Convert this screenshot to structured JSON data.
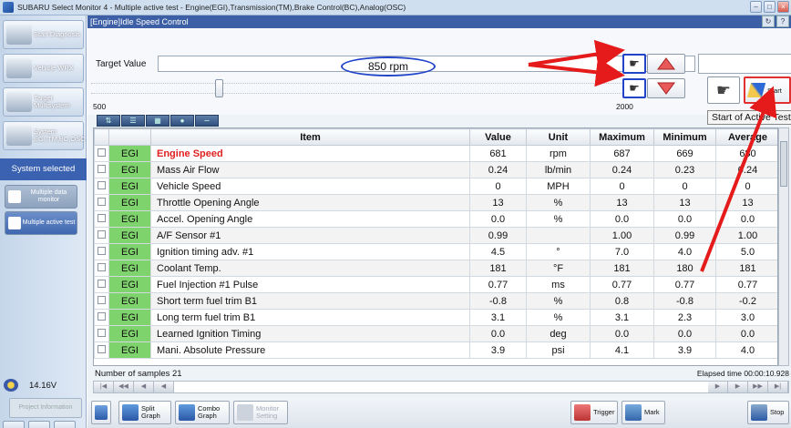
{
  "window": {
    "title": "SUBARU Select Monitor 4 - Multiple active test - Engine(EGI),Transmission(TM),Brake Control(BC),Analog(OSC)"
  },
  "sidebar": {
    "start": "Start Diagnosis",
    "vehicle": "Vehicle WRX",
    "target": "Target Multisystem",
    "system": "System EGI,TM,BC,OSC",
    "selected_label": "System selected",
    "multi_data": "Multiple data monitor",
    "multi_active": "Multiple active test",
    "voltage": "14.16V",
    "project_info": "Project Information"
  },
  "panel": {
    "header": "[Engine]Idle Speed Control",
    "target_label": "Target Value",
    "target_value": "850 rpm",
    "slider_min": "500",
    "slider_max": "2000",
    "slider_value": 850,
    "start_label": "Start",
    "tooltip": "Start of Active Test"
  },
  "table": {
    "headers": [
      "",
      "",
      "Item",
      "Value",
      "Unit",
      "Maximum",
      "Minimum",
      "Average"
    ],
    "rows": [
      {
        "sys": "EGI",
        "item": "Engine Speed",
        "value": "681",
        "unit": "rpm",
        "max": "687",
        "min": "669",
        "avg": "680"
      },
      {
        "sys": "EGI",
        "item": "Mass Air Flow",
        "value": "0.24",
        "unit": "lb/min",
        "max": "0.24",
        "min": "0.23",
        "avg": "0.24"
      },
      {
        "sys": "EGI",
        "item": "Vehicle Speed",
        "value": "0",
        "unit": "MPH",
        "max": "0",
        "min": "0",
        "avg": "0"
      },
      {
        "sys": "EGI",
        "item": "Throttle Opening Angle",
        "value": "13",
        "unit": "%",
        "max": "13",
        "min": "13",
        "avg": "13"
      },
      {
        "sys": "EGI",
        "item": "Accel. Opening Angle",
        "value": "0.0",
        "unit": "%",
        "max": "0.0",
        "min": "0.0",
        "avg": "0.0"
      },
      {
        "sys": "EGI",
        "item": "A/F Sensor #1",
        "value": "0.99",
        "unit": "",
        "max": "1.00",
        "min": "0.99",
        "avg": "1.00"
      },
      {
        "sys": "EGI",
        "item": "Ignition timing adv. #1",
        "value": "4.5",
        "unit": "°",
        "max": "7.0",
        "min": "4.0",
        "avg": "5.0"
      },
      {
        "sys": "EGI",
        "item": "Coolant Temp.",
        "value": "181",
        "unit": "°F",
        "max": "181",
        "min": "180",
        "avg": "181"
      },
      {
        "sys": "EGI",
        "item": "Fuel Injection #1 Pulse",
        "value": "0.77",
        "unit": "ms",
        "max": "0.77",
        "min": "0.77",
        "avg": "0.77"
      },
      {
        "sys": "EGI",
        "item": "Short term fuel trim B1",
        "value": "-0.8",
        "unit": "%",
        "max": "0.8",
        "min": "-0.8",
        "avg": "-0.2"
      },
      {
        "sys": "EGI",
        "item": "Long term fuel trim B1",
        "value": "3.1",
        "unit": "%",
        "max": "3.1",
        "min": "2.3",
        "avg": "3.0"
      },
      {
        "sys": "EGI",
        "item": "Learned Ignition Timing",
        "value": "0.0",
        "unit": "deg",
        "max": "0.0",
        "min": "0.0",
        "avg": "0.0"
      },
      {
        "sys": "EGI",
        "item": "Mani. Absolute Pressure",
        "value": "3.9",
        "unit": "psi",
        "max": "4.1",
        "min": "3.9",
        "avg": "4.0"
      }
    ]
  },
  "status": {
    "samples": "Number of samples 21",
    "elapsed": "Elapsed time 00:00:10.928"
  },
  "bottom": {
    "split": "Split Graph",
    "combo": "Combo Graph",
    "monitor": "Monitor Setting",
    "trigger": "Trigger",
    "mark": "Mark",
    "stop": "Stop"
  },
  "colors": {
    "highlight_row": "#e02020",
    "system_cell": "#7fd36c",
    "selected_bg": "#3a62b0",
    "annotation_red": "#e51a1a",
    "annotation_blue": "#2244c8"
  }
}
